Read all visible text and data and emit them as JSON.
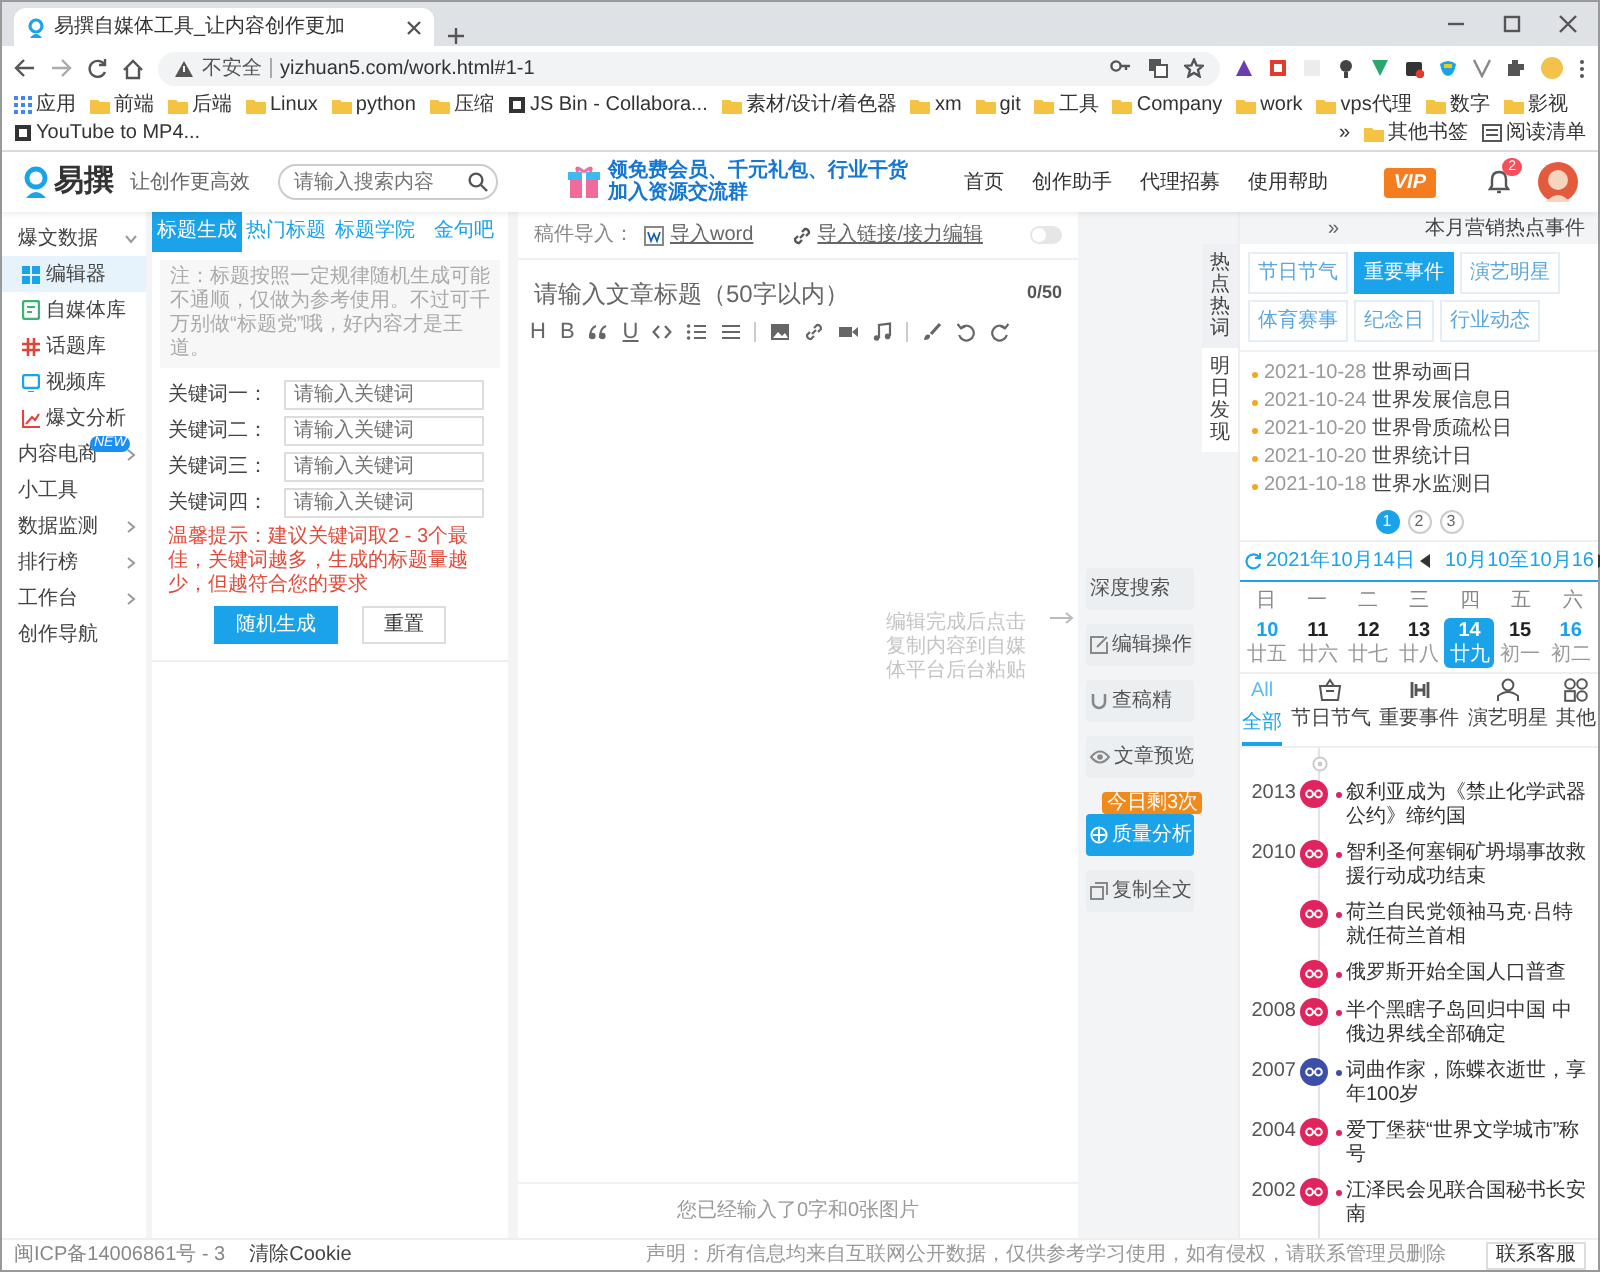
{
  "browser": {
    "tab_title": "易撰自媒体工具_让内容创作更加",
    "security": "不安全",
    "url": "yizhuan5.com/work.html#1-1",
    "bookmarks": [
      {
        "label": "应用",
        "kind": "apps"
      },
      {
        "label": "前端",
        "kind": "folder"
      },
      {
        "label": "后端",
        "kind": "folder"
      },
      {
        "label": "Linux",
        "kind": "folder"
      },
      {
        "label": "python",
        "kind": "folder"
      },
      {
        "label": "压缩",
        "kind": "folder"
      },
      {
        "label": "JS Bin - Collabora...",
        "kind": "site"
      },
      {
        "label": "素材/设计/着色器",
        "kind": "folder"
      },
      {
        "label": "xm",
        "kind": "folder"
      },
      {
        "label": "git",
        "kind": "folder"
      },
      {
        "label": "工具",
        "kind": "folder"
      },
      {
        "label": "Company",
        "kind": "folder"
      },
      {
        "label": "work",
        "kind": "folder"
      },
      {
        "label": "vps代理",
        "kind": "folder"
      },
      {
        "label": "数字",
        "kind": "folder"
      },
      {
        "label": "影视",
        "kind": "folder"
      },
      {
        "label": "YouTube to MP4...",
        "kind": "site"
      },
      {
        "label": "»",
        "kind": "more"
      },
      {
        "label": "其他书签",
        "kind": "folder"
      },
      {
        "label": "阅读清单",
        "kind": "reading"
      }
    ]
  },
  "header": {
    "logo": "易撰",
    "slogan": "让创作更高效",
    "search": {
      "placeholder": "请输入搜索内容"
    },
    "banner": [
      "领免费会员、千元礼包、行业干货",
      "加入资源交流群"
    ],
    "nav": [
      "首页",
      "创作助手",
      "代理招募",
      "使用帮助"
    ],
    "vip": "VIP",
    "notification_count": "2"
  },
  "sidebar": {
    "items": [
      {
        "label": "爆文数据",
        "kind": "group",
        "expanded": true,
        "children": [
          {
            "label": "编辑器",
            "selected": true
          },
          {
            "label": "自媒体库",
            "selected": false
          },
          {
            "label": "话题库",
            "selected": false
          },
          {
            "label": "视频库",
            "selected": false
          },
          {
            "label": "爆文分析",
            "selected": false
          }
        ]
      },
      {
        "label": "内容电商",
        "kind": "group",
        "expanded": false,
        "badge": "NEW"
      },
      {
        "label": "小工具",
        "kind": "link"
      },
      {
        "label": "数据监测",
        "kind": "group",
        "expanded": false
      },
      {
        "label": "排行榜",
        "kind": "group",
        "expanded": false
      },
      {
        "label": "工作台",
        "kind": "group",
        "expanded": false
      },
      {
        "label": "创作导航",
        "kind": "link"
      }
    ]
  },
  "tool_panel": {
    "tabs": [
      {
        "label": "标题生成",
        "selected": true
      },
      {
        "label": "热门标题",
        "selected": false
      },
      {
        "label": "标题学院",
        "selected": false
      },
      {
        "label": "金句吧",
        "selected": false
      }
    ],
    "note": "注：标题按照一定规律随机生成可能不通顺，仅做为参考使用。不过可千万别做“标题党”哦，好内容才是王道。",
    "keywords": [
      {
        "label": "关键词一：",
        "placeholder": "请输入关键词"
      },
      {
        "label": "关键词二：",
        "placeholder": "请输入关键词"
      },
      {
        "label": "关键词三：",
        "placeholder": "请输入关键词"
      },
      {
        "label": "关键词四：",
        "placeholder": "请输入关键词"
      }
    ],
    "tip": "温馨提示：建议关键词取2 - 3个最佳，关键词越多，生成的标题量越少，但越符合您的要求",
    "buttons": [
      {
        "label": "随机生成",
        "kind": "primary"
      },
      {
        "label": "重置",
        "kind": "secondary"
      }
    ]
  },
  "editor": {
    "import_label": "稿件导入：",
    "import_word": "导入word",
    "import_link": "导入链接/接力编辑",
    "toggle": {
      "on": false
    },
    "title_placeholder": "请输入文章标题（50字以内）",
    "counter": "0/50",
    "toolbar": [
      {
        "kind": "heading",
        "label": "H"
      },
      {
        "kind": "bold",
        "label": "B"
      },
      {
        "kind": "quote"
      },
      {
        "kind": "underline",
        "label": "U"
      },
      {
        "kind": "code"
      },
      {
        "kind": "ol"
      },
      {
        "kind": "ul"
      },
      {
        "kind": "divider"
      },
      {
        "kind": "image"
      },
      {
        "kind": "link"
      },
      {
        "kind": "video"
      },
      {
        "kind": "music"
      },
      {
        "kind": "divider"
      },
      {
        "kind": "brush"
      },
      {
        "kind": "undo"
      },
      {
        "kind": "redo"
      }
    ],
    "hint": "编辑完成后点击复制内容到自媒体平台后台粘贴",
    "status": "您已经输入了0字和0张图片"
  },
  "actions": [
    {
      "label": "深度搜索",
      "highlighted": false
    },
    {
      "label": "编辑操作",
      "highlighted": false
    },
    {
      "label": "查稿精",
      "highlighted": false
    },
    {
      "label": "文章预览",
      "highlighted": false
    },
    {
      "label": "质量分析",
      "highlighted": true,
      "badge": "今日剩3次"
    },
    {
      "label": "复制全文",
      "highlighted": false
    }
  ],
  "hot_panel": {
    "collapse": "»",
    "title": "本月营销热点事件",
    "side_tabs": [
      {
        "label": "热点热词",
        "selected": true
      },
      {
        "label": "明日发现",
        "selected": false
      }
    ],
    "categories": [
      {
        "label": "节日节气",
        "selected": false
      },
      {
        "label": "重要事件",
        "selected": true
      },
      {
        "label": "演艺明星",
        "selected": false
      },
      {
        "label": "体育赛事",
        "selected": false
      },
      {
        "label": "纪念日",
        "selected": false
      },
      {
        "label": "行业动态",
        "selected": false
      }
    ],
    "events": [
      {
        "date": "2021-10-28",
        "name": "世界动画日"
      },
      {
        "date": "2021-10-24",
        "name": "世界发展信息日"
      },
      {
        "date": "2021-10-20",
        "name": "世界骨质疏松日"
      },
      {
        "date": "2021-10-20",
        "name": "世界统计日"
      },
      {
        "date": "2021-10-18",
        "name": "世界水监测日"
      }
    ],
    "pages": [
      {
        "label": "1",
        "selected": true
      },
      {
        "label": "2",
        "selected": false
      },
      {
        "label": "3",
        "selected": false
      }
    ],
    "date": "2021年10月14日",
    "range": "10月10至10月16",
    "weekdays": [
      "日",
      "一",
      "二",
      "三",
      "四",
      "五",
      "六"
    ],
    "days": [
      {
        "day": "10",
        "lunar": "廿五",
        "weekend": true,
        "selected": false
      },
      {
        "day": "11",
        "lunar": "廿六",
        "weekend": false,
        "selected": false
      },
      {
        "day": "12",
        "lunar": "廿七",
        "weekend": false,
        "selected": false
      },
      {
        "day": "13",
        "lunar": "廿八",
        "weekend": false,
        "selected": false
      },
      {
        "day": "14",
        "lunar": "廿九",
        "weekend": false,
        "selected": true
      },
      {
        "day": "15",
        "lunar": "初一",
        "weekend": false,
        "selected": false
      },
      {
        "day": "16",
        "lunar": "初二",
        "weekend": true,
        "selected": false
      }
    ],
    "filters": [
      {
        "label": "全部",
        "mark": "All",
        "selected": true
      },
      {
        "label": "节日节气",
        "selected": false
      },
      {
        "label": "重要事件",
        "selected": false
      },
      {
        "label": "演艺明星",
        "selected": false
      },
      {
        "label": "其他",
        "selected": false
      }
    ],
    "timeline": [
      {
        "year": "2013",
        "color": "#e0245e",
        "text": "叙利亚成为《禁止化学武器公约》缔约国"
      },
      {
        "year": "2010",
        "color": "#e0245e",
        "text": "智利圣何塞铜矿坍塌事故救援行动成功结束"
      },
      {
        "color": "#e0245e",
        "text": "荷兰自民党领袖马克·吕特就任荷兰首相"
      },
      {
        "color": "#e0245e",
        "text": "俄罗斯开始全国人口普查"
      },
      {
        "year": "2008",
        "color": "#e0245e",
        "text": "半个黑瞎子岛回归中国 中俄边界线全部确定"
      },
      {
        "year": "2007",
        "color": "#3b4fa8",
        "text": "词曲作家，陈蝶衣逝世，享年100岁"
      },
      {
        "year": "2004",
        "color": "#e0245e",
        "text": "爱丁堡获“世界文学城市”称号"
      },
      {
        "year": "2002",
        "color": "#e0245e",
        "text": "江泽民会见联合国秘书长安南"
      }
    ]
  },
  "footer": {
    "icp": "闽ICP备14006861号 - 3",
    "clear_cookie": "清除Cookie",
    "disclaimer": "声明：所有信息均来自互联网公开数据，仅供参考学习使用，如有侵权，请联系管理员删除",
    "contact": "联系客服"
  }
}
